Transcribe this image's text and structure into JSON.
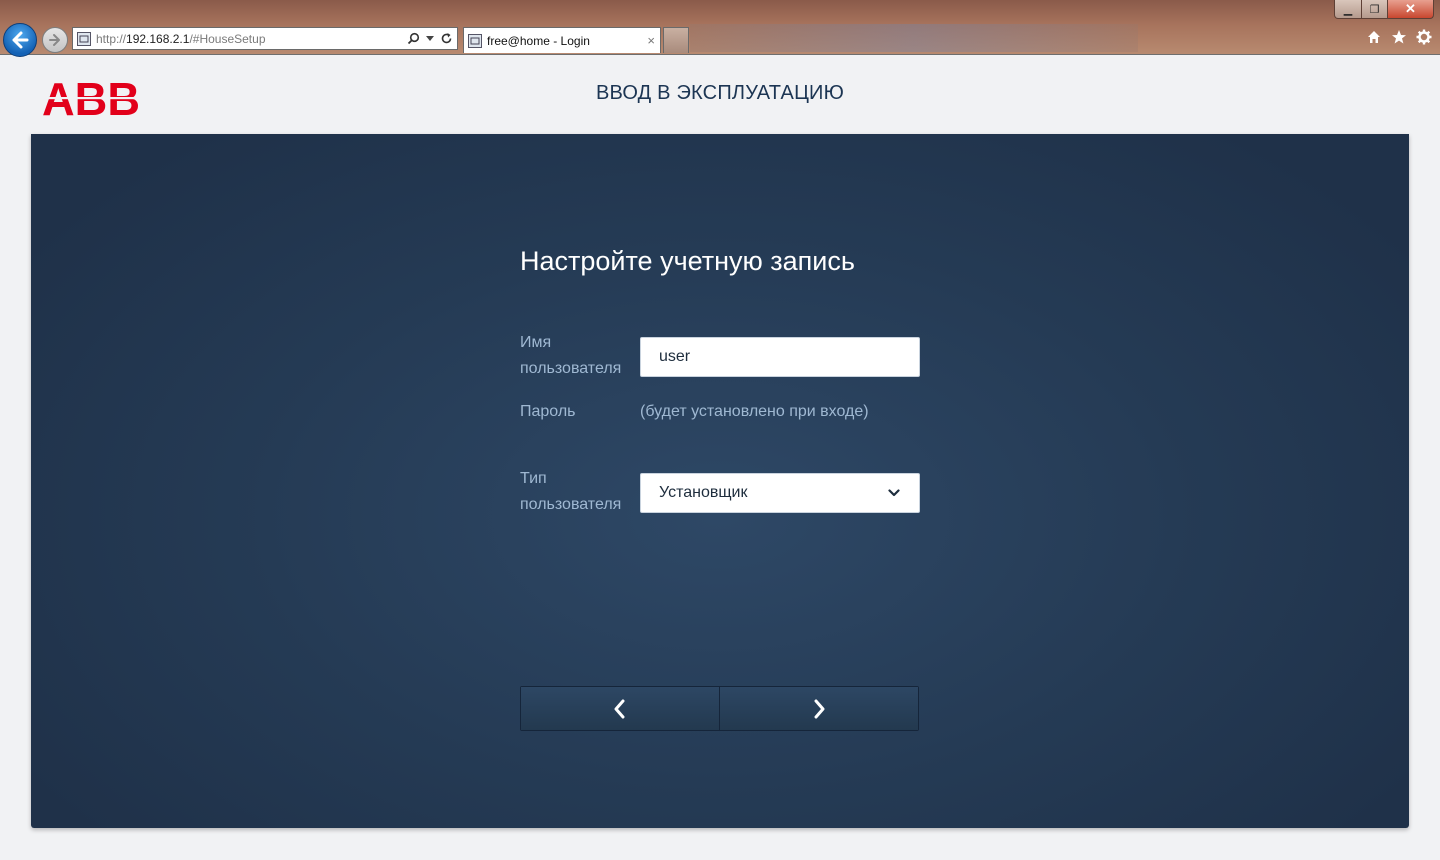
{
  "browser": {
    "address_prefix": "http://",
    "address_host": "192.168.2.1",
    "address_path": "/#HouseSetup",
    "tab_title": "free@home - Login",
    "tab_close": "×",
    "window_controls": {
      "min": "▁",
      "max": "❐",
      "close": "✕"
    },
    "toolbar_icons": [
      "home-icon",
      "favorites-star-icon",
      "settings-gear-icon"
    ]
  },
  "header": {
    "logo_text": "ABB",
    "title": "ВВОД В ЭКСПЛУАТАЦИЮ",
    "brand_color": "#e2001a"
  },
  "form": {
    "title": "Настройте учетную запись",
    "username_label": "Имя пользователя",
    "username_value": "user",
    "password_label": "Пароль",
    "password_value": "(будет установлено при входе)",
    "user_type_label": "Тип пользователя",
    "user_type_value": "Установщик",
    "nav": {
      "back_icon": "chevron-left-icon",
      "next_icon": "chevron-right-icon"
    }
  },
  "colors": {
    "panel": "#253b55",
    "label": "#9fb8d2",
    "title_text": "#1c3553"
  }
}
